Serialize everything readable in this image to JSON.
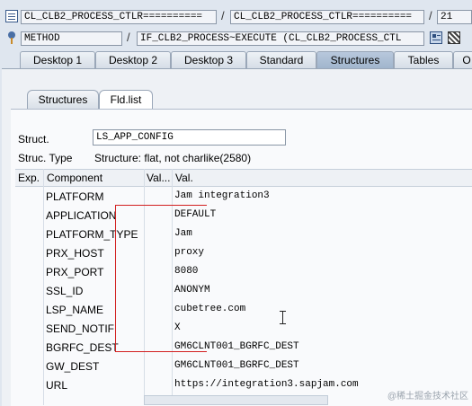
{
  "toolbar": {
    "row1": {
      "field1": "CL_CLB2_PROCESS_CTLR==========",
      "field2": "CL_CLB2_PROCESS_CTLR==========",
      "field3": "21"
    },
    "row2": {
      "field1": "METHOD",
      "field2": "IF_CLB2_PROCESS~EXECUTE (CL_CLB2_PROCESS_CTL"
    }
  },
  "main_tabs": [
    "Desktop 1",
    "Desktop 2",
    "Desktop 3",
    "Standard",
    "Structures",
    "Tables",
    "O"
  ],
  "sub_tabs": [
    "Structures",
    "Fld.list"
  ],
  "struct": {
    "label": "Struct.",
    "value": "LS_APP_CONFIG",
    "type_label": "Struc. Type",
    "type_value": "Structure: flat, not charlike(2580)"
  },
  "table": {
    "headers": [
      "Exp.",
      "Component",
      "Val...",
      "Val."
    ],
    "rows": [
      {
        "component": "PLATFORM",
        "value": "Jam integration3"
      },
      {
        "component": "APPLICATION",
        "value": "DEFAULT"
      },
      {
        "component": "PLATFORM_TYPE",
        "value": "Jam"
      },
      {
        "component": "PRX_HOST",
        "value": "proxy"
      },
      {
        "component": "PRX_PORT",
        "value": "8080"
      },
      {
        "component": "SSL_ID",
        "value": "ANONYM"
      },
      {
        "component": "LSP_NAME",
        "value": "cubetree.com"
      },
      {
        "component": "SEND_NOTIF",
        "value": "X"
      },
      {
        "component": "BGRFC_DEST",
        "value": "GM6CLNT001_BGRFC_DEST"
      },
      {
        "component": "GW_DEST",
        "value": "GM6CLNT001_BGRFC_DEST"
      },
      {
        "component": "URL",
        "value": "https://integration3.sapjam.com"
      }
    ]
  },
  "watermark": "@稀土掘金技术社区",
  "colors": {
    "accent_tab": "#a9bdd4",
    "annotation_red": "#d21f1f"
  }
}
